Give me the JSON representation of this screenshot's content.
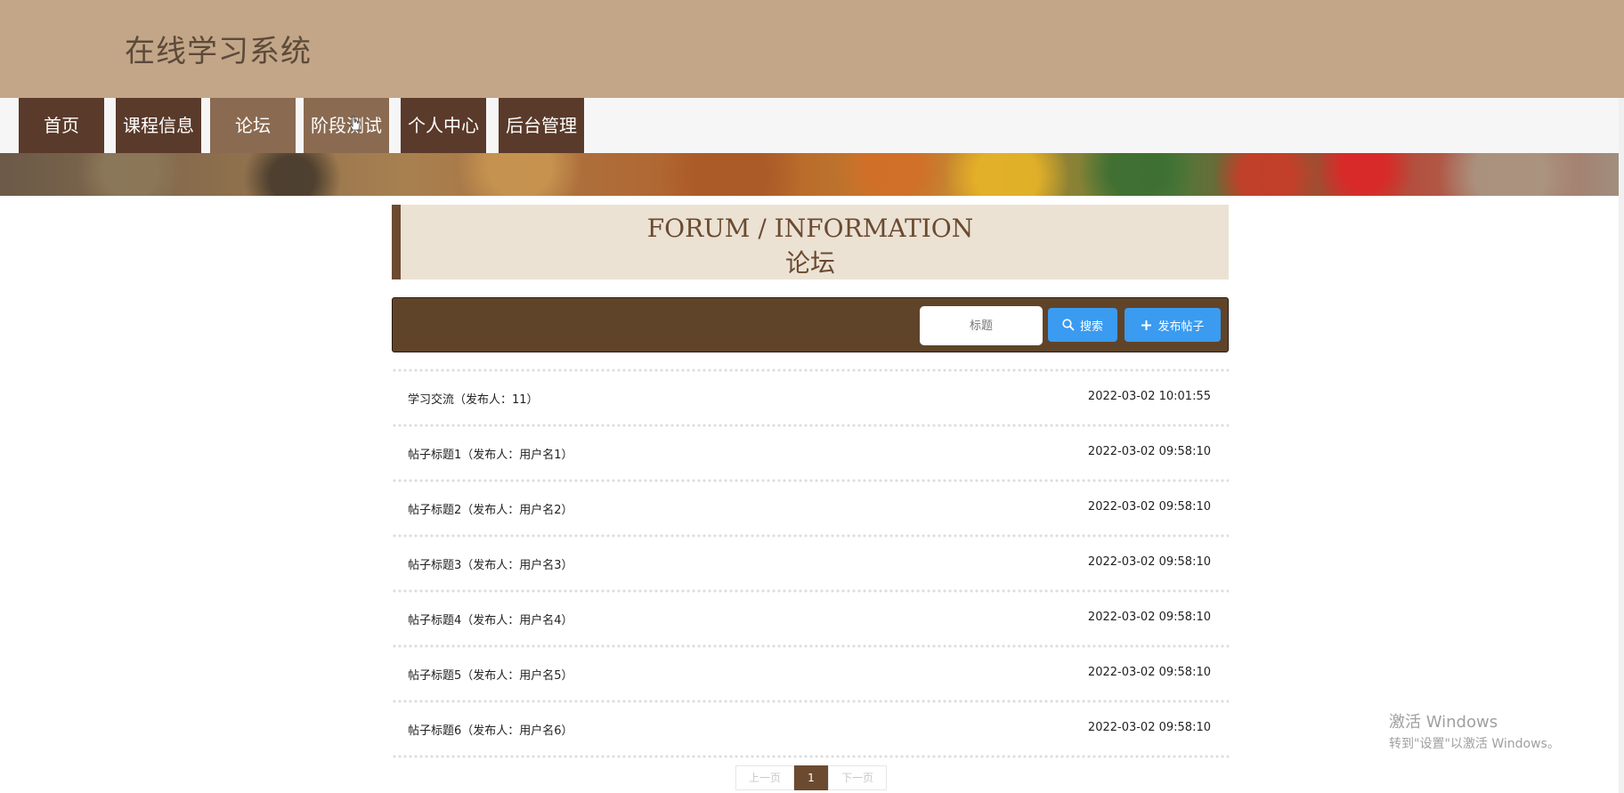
{
  "site": {
    "title": "在线学习系统"
  },
  "nav": {
    "items": [
      {
        "label": "首页"
      },
      {
        "label": "课程信息"
      },
      {
        "label": "论坛"
      },
      {
        "label": "阶段测试"
      },
      {
        "label": "个人中心"
      },
      {
        "label": "后台管理"
      }
    ]
  },
  "section": {
    "title_en": "FORUM / INFORMATION",
    "title_zh": "论坛"
  },
  "toolbar": {
    "search_placeholder": "标题",
    "search_label": "搜索",
    "post_label": "发布帖子"
  },
  "posts": [
    {
      "title": "学习交流（发布人：11）",
      "time": "2022-03-02 10:01:55"
    },
    {
      "title": "帖子标题1（发布人：用户名1）",
      "time": "2022-03-02 09:58:10"
    },
    {
      "title": "帖子标题2（发布人：用户名2）",
      "time": "2022-03-02 09:58:10"
    },
    {
      "title": "帖子标题3（发布人：用户名3）",
      "time": "2022-03-02 09:58:10"
    },
    {
      "title": "帖子标题4（发布人：用户名4）",
      "time": "2022-03-02 09:58:10"
    },
    {
      "title": "帖子标题5（发布人：用户名5）",
      "time": "2022-03-02 09:58:10"
    },
    {
      "title": "帖子标题6（发布人：用户名6）",
      "time": "2022-03-02 09:58:10"
    }
  ],
  "pager": {
    "prev": "上一页",
    "current": "1",
    "next": "下一页"
  },
  "watermark": {
    "line1": "激活 Windows",
    "line2": "转到\"设置\"以激活 Windows。"
  },
  "colors": {
    "header_bg": "#c3a688",
    "nav_bg": "#5a3a2a",
    "nav_active_bg": "#8a6a50",
    "toolbar_bg": "#604429",
    "accent_blue": "#3a9bf0",
    "section_bg": "#ebe2d4"
  }
}
